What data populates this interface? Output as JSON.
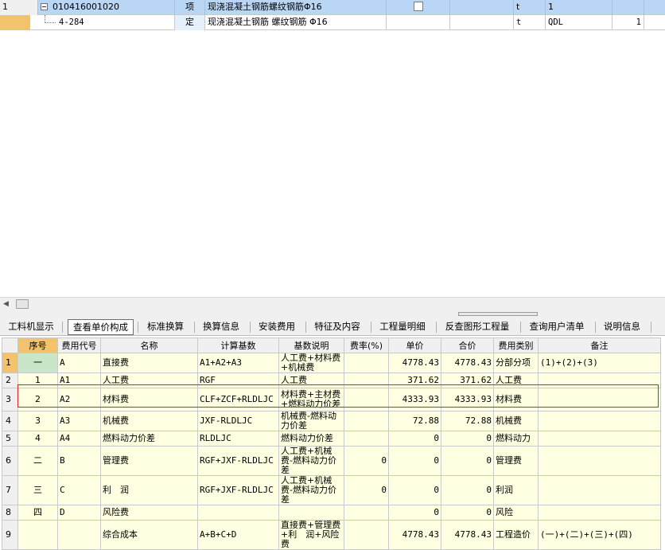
{
  "top_rows": [
    {
      "row": "1",
      "code": "010416001020",
      "type": "项",
      "name": "现浇混凝土钢筋螺纹钢筋Φ16",
      "unit": "t",
      "qty": "1",
      "amount": ""
    },
    {
      "row": "",
      "code": "4-284",
      "type": "定",
      "name": "现浇混凝土钢筋 螺纹钢筋 Φ16",
      "unit": "t",
      "qty": "QDL",
      "amount": "1"
    }
  ],
  "tabs": [
    {
      "label": "工料机显示"
    },
    {
      "label": "查看单价构成"
    },
    {
      "label": "标准换算"
    },
    {
      "label": "换算信息"
    },
    {
      "label": "安装费用"
    },
    {
      "label": "特征及内容"
    },
    {
      "label": "工程量明细"
    },
    {
      "label": "反查图形工程量"
    },
    {
      "label": "查询用户清单"
    },
    {
      "label": "说明信息"
    }
  ],
  "table": {
    "headers": [
      "序号",
      "费用代号",
      "名称",
      "计算基数",
      "基数说明",
      "费率(%)",
      "单价",
      "合价",
      "费用类别",
      "备注"
    ],
    "rows": [
      {
        "n": "1",
        "seq": "一",
        "code": "A",
        "name": "直接费",
        "base": "A1+A2+A3",
        "desc": "人工费+材料费+机械费",
        "rate": "",
        "price": "4778.43",
        "total": "4778.43",
        "cat": "分部分项",
        "note": "(1)+(2)+(3)"
      },
      {
        "n": "2",
        "seq": "1",
        "code": "A1",
        "name": "人工费",
        "base": "RGF",
        "desc": "人工费",
        "rate": "",
        "price": "371.62",
        "total": "371.62",
        "cat": "人工费",
        "note": ""
      },
      {
        "n": "3",
        "seq": "2",
        "code": "A2",
        "name": "材料费",
        "base": "CLF+ZCF+RLDLJC",
        "desc": "材料费+主材费+燃料动力价差",
        "rate": "",
        "price": "4333.93",
        "total": "4333.93",
        "cat": "材料费",
        "note": ""
      },
      {
        "n": "4",
        "seq": "3",
        "code": "A3",
        "name": "机械费",
        "base": "JXF-RLDLJC",
        "desc": "机械费-燃料动力价差",
        "rate": "",
        "price": "72.88",
        "total": "72.88",
        "cat": "机械费",
        "note": ""
      },
      {
        "n": "5",
        "seq": "4",
        "code": "A4",
        "name": "燃料动力价差",
        "base": "RLDLJC",
        "desc": "燃料动力价差",
        "rate": "",
        "price": "0",
        "total": "0",
        "cat": "燃料动力",
        "note": ""
      },
      {
        "n": "6",
        "seq": "二",
        "code": "B",
        "name": "管理费",
        "base": "RGF+JXF-RLDLJC",
        "desc": "人工费+机械费-燃料动力价差",
        "rate": "0",
        "price": "0",
        "total": "0",
        "cat": "管理费",
        "note": ""
      },
      {
        "n": "7",
        "seq": "三",
        "code": "C",
        "name": "利　润",
        "base": "RGF+JXF-RLDLJC",
        "desc": "人工费+机械费-燃料动力价差",
        "rate": "0",
        "price": "0",
        "total": "0",
        "cat": "利润",
        "note": ""
      },
      {
        "n": "8",
        "seq": "四",
        "code": "D",
        "name": "风险费",
        "base": "",
        "desc": "",
        "rate": "",
        "price": "0",
        "total": "0",
        "cat": "风险",
        "note": ""
      },
      {
        "n": "9",
        "seq": "",
        "code": "",
        "name": "综合成本",
        "base": "A+B+C+D",
        "desc": "直接费+管理费+利　润+风险费",
        "rate": "",
        "price": "4778.43",
        "total": "4778.43",
        "cat": "工程造价",
        "note": "(一)+(二)+(三)+(四)"
      }
    ]
  },
  "colors": {
    "selected_row": "#b9d7f5",
    "editable_cell": "#ffffe1",
    "selection_border": "#e02020",
    "header_accent": "#f2c26c"
  }
}
